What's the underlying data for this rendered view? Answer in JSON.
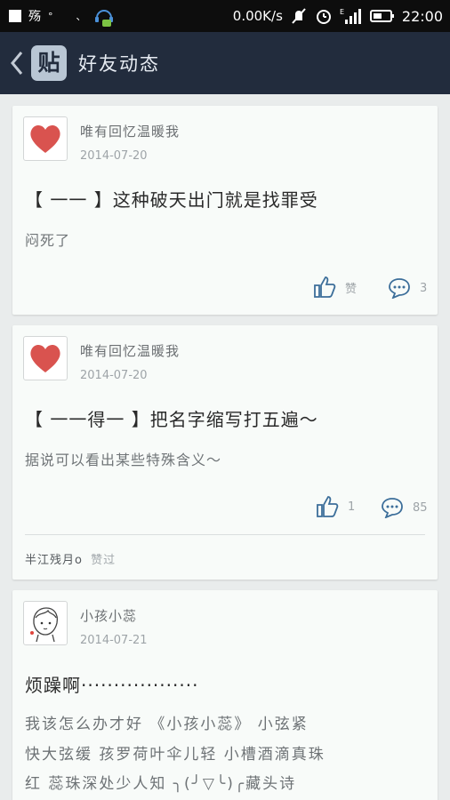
{
  "status_bar": {
    "carrier_char": "殇",
    "speed": "0.00K/s",
    "time": "22:00",
    "signal_label": "E"
  },
  "header": {
    "logo_text": "贴",
    "title": "好友动态"
  },
  "posts": [
    {
      "username": "唯有回忆温暖我",
      "date": "2014-07-20",
      "title": "【 一一 】这种破天出门就是找罪受",
      "body": "闷死了",
      "like_label": "赞",
      "comment_count": "3"
    },
    {
      "username": "唯有回忆温暖我",
      "date": "2014-07-20",
      "title": "【 一一得一 】把名字缩写打五遍～",
      "body": "据说可以看出某些特殊含义～",
      "like_label": "1",
      "comment_count": "85",
      "liked_by": "半江残月o",
      "liked_suffix": "赞过"
    },
    {
      "username": "小孩小蕊",
      "date": "2014-07-21",
      "title": "烦躁啊··················",
      "body_lines": [
        "我该怎么办才好    《小孩小蕊》     小弦紧",
        "快大弦缓   孩罗荷叶伞儿轻   小槽酒滴真珠",
        "红   蕊珠深处少人知   ╮(╯▽╰)╭藏头诗"
      ]
    }
  ],
  "colors": {
    "header_bg": "#222c3d",
    "accent_blue": "#3c6e9a",
    "heart": "#d9534f"
  }
}
